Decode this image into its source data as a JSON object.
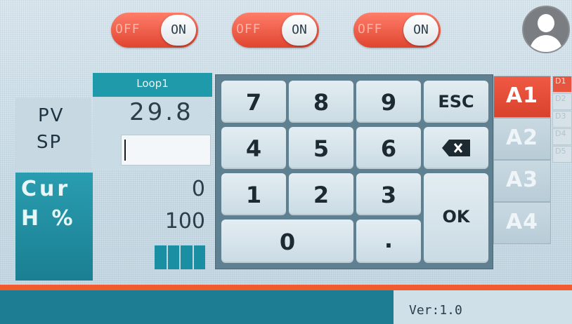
{
  "toggles": [
    {
      "off_label": "OFF",
      "on_label": "ON"
    },
    {
      "off_label": "OFF",
      "on_label": "ON"
    },
    {
      "off_label": "OFF",
      "on_label": "ON"
    }
  ],
  "user": {
    "icon": "user-avatar-icon"
  },
  "loop": {
    "title": "Loop1",
    "pv_label": "PV",
    "sp_label": "SP",
    "pv_value": "29.8",
    "sp_value": "",
    "cur_label": "Cur",
    "h_label": "H %",
    "cur_value": "0",
    "h_value": "100",
    "output_level_fraction": 1.0
  },
  "keypad": {
    "keys": [
      "7",
      "8",
      "9",
      "ESC",
      "4",
      "5",
      "6",
      "",
      "1",
      "2",
      "3",
      "OK",
      "0",
      "."
    ],
    "backspace_icon": "backspace-icon"
  },
  "alarms": [
    {
      "label": "A1",
      "active": true
    },
    {
      "label": "A2",
      "active": false
    },
    {
      "label": "A3",
      "active": false
    },
    {
      "label": "A4",
      "active": false
    }
  ],
  "digital": [
    {
      "label": "D1",
      "active": true
    },
    {
      "label": "D2",
      "active": false
    },
    {
      "label": "D3",
      "active": false
    },
    {
      "label": "D4",
      "active": false
    },
    {
      "label": "D5",
      "active": false
    }
  ],
  "footer": {
    "version": "Ver:1.0"
  },
  "colors": {
    "accent": "#1f9aab",
    "alarm_active": "#e8553e",
    "toggle_off": "#e0452f"
  }
}
